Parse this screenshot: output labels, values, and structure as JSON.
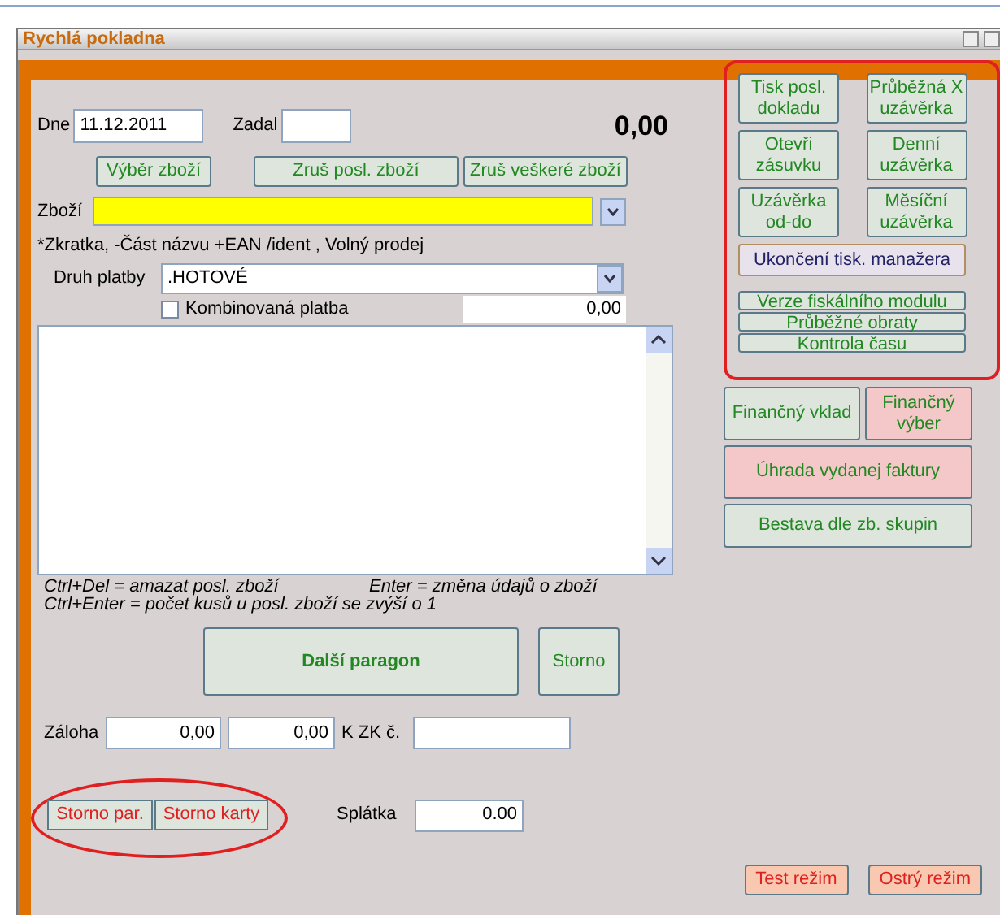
{
  "window": {
    "title": "Rychlá pokladna"
  },
  "header": {
    "date_label": "Dne",
    "date": "11.12.2011",
    "entered_by_label": "Zadal",
    "total": "0,00"
  },
  "item_buttons": [
    "Výběr zboží",
    "Zruš posl. zboží",
    "Zruš veškeré zboží"
  ],
  "goods": {
    "label": "Zboží",
    "hint": "*Zkratka, -Část názvu +EAN /ident , Volný prodej"
  },
  "payment": {
    "label": "Druh platby",
    "value": ".HOTOVÉ",
    "combined": {
      "label": "Kombinovaná platba",
      "checked": false
    },
    "amount": "0,00"
  },
  "shortcuts": [
    "Ctrl+Del = amazat posl. zboží",
    "Enter = změna údajů o zboží",
    "Ctrl+Enter = počet kusů u posl. zboží se zvýší o 1"
  ],
  "actions": [
    "Další paragon",
    "Storno"
  ],
  "deposit": {
    "label": "Záloha",
    "value_1": "0,00",
    "value_2": "0,00",
    "kzk_label": "K ZK č."
  },
  "cancel_buttons": [
    "Storno par.",
    "Storno karty"
  ],
  "installment": {
    "label": "Splátka",
    "value": "0.00"
  },
  "fiscal_buttons": [
    {
      "label": "Tisk posl.\ndokladu",
      "kind": "grid"
    },
    {
      "label": "Průběžná X\nuzávěrka",
      "kind": "grid"
    },
    {
      "label": "Otevři\nzásuvku",
      "kind": "grid"
    },
    {
      "label": "Denní\nuzávěrka",
      "kind": "grid"
    },
    {
      "label": "Uzávěrka\nod-do",
      "kind": "grid"
    },
    {
      "label": "Měsíční\nuzávěrka",
      "kind": "grid"
    },
    {
      "label": "Ukončení tisk. manažera",
      "kind": "wide"
    },
    {
      "label": "Verze fiskálního modulu",
      "kind": "slim"
    },
    {
      "label": "Průběžné obraty",
      "kind": "slim"
    },
    {
      "label": "Kontrola času",
      "kind": "slim"
    }
  ],
  "finance_buttons": [
    {
      "label": "Finančný vklad",
      "color": "#dde5dd",
      "kind": "half"
    },
    {
      "label": "Finančný\nvýber",
      "color": "#f4c8c8",
      "kind": "half"
    },
    {
      "label": "Úhrada vydanej faktury",
      "color": "#f4c8c8",
      "kind": "tall"
    },
    {
      "label": "Bestava dle zb. skupin",
      "color": "#dde5dd",
      "kind": "full"
    }
  ],
  "mode_buttons": [
    "Test režim",
    "Ostrý režim"
  ]
}
